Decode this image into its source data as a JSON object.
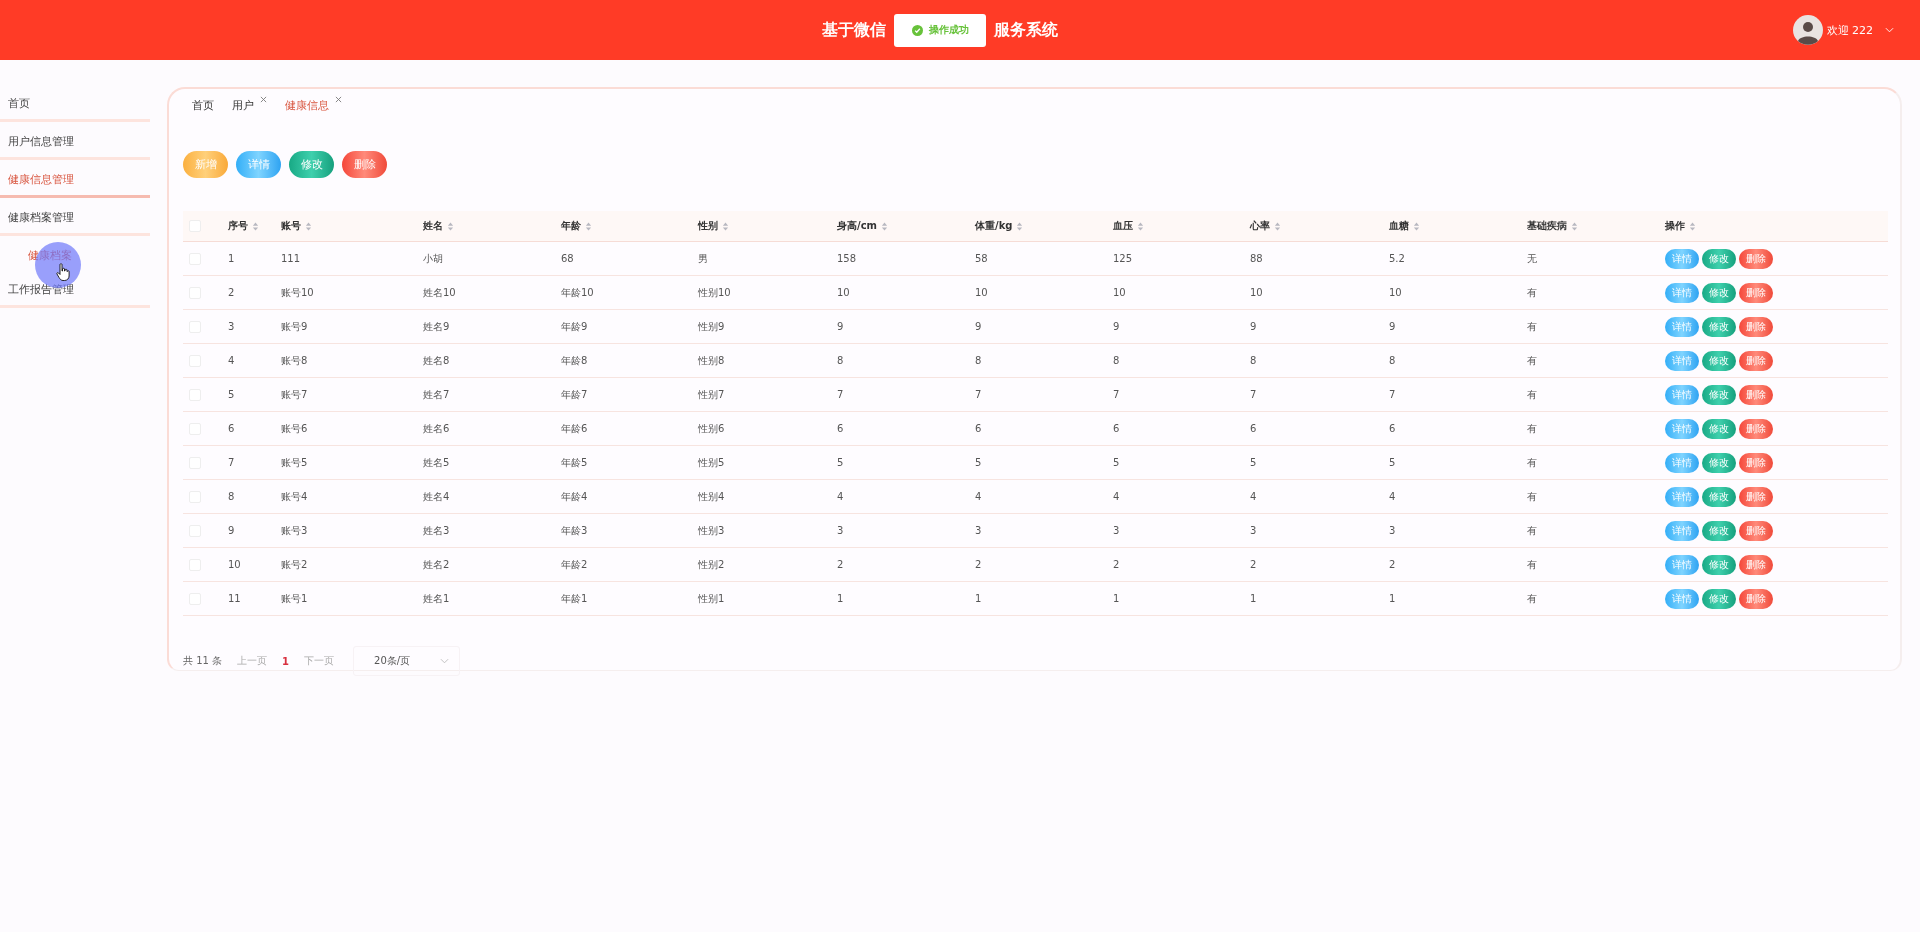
{
  "header": {
    "title_parts": [
      "基于微信",
      "服务系统"
    ],
    "user": "欢迎 222"
  },
  "toast": {
    "message": "操作成功"
  },
  "sidebar": {
    "items": [
      {
        "label": "首页",
        "selected": false
      },
      {
        "label": "用户信息管理",
        "selected": false
      },
      {
        "label": "健康信息管理",
        "selected": true
      },
      {
        "label": "健康档案管理",
        "selected": false,
        "children": [
          {
            "label": "健康档案",
            "hovered": true
          }
        ]
      },
      {
        "label": "工作报告管理",
        "selected": false
      }
    ]
  },
  "tabs": [
    {
      "label": "首页",
      "selected": false,
      "closable": false
    },
    {
      "label": "用户",
      "selected": false,
      "closable": true
    },
    {
      "label": "健康信息",
      "selected": true,
      "closable": true
    }
  ],
  "toolbar": [
    {
      "label": "新增",
      "kind": "add"
    },
    {
      "label": "详情",
      "kind": "detail"
    },
    {
      "label": "修改",
      "kind": "edit"
    },
    {
      "label": "删除",
      "kind": "delete"
    }
  ],
  "table": {
    "select_all": {
      "checked": false
    },
    "columns": [
      "序号",
      "账号",
      "姓名",
      "年龄",
      "性别",
      "身高/cm",
      "体重/kg",
      "血压",
      "心率",
      "血糖",
      "基础疾病",
      "操作"
    ],
    "rows": [
      {
        "checked": false,
        "cells": [
          "1",
          "111",
          "小胡",
          "68",
          "男",
          "158",
          "58",
          "125",
          "88",
          "5.2",
          "无"
        ],
        "actions": [
          {
            "label": "详情",
            "kind": "detail"
          },
          {
            "label": "修改",
            "kind": "edit"
          },
          {
            "label": "删除",
            "kind": "delete"
          }
        ]
      },
      {
        "checked": false,
        "cells": [
          "2",
          "账号10",
          "姓名10",
          "年龄10",
          "性别10",
          "10",
          "10",
          "10",
          "10",
          "10",
          "有"
        ],
        "actions": [
          {
            "label": "详情",
            "kind": "detail"
          },
          {
            "label": "修改",
            "kind": "edit"
          },
          {
            "label": "删除",
            "kind": "delete"
          }
        ]
      },
      {
        "checked": false,
        "cells": [
          "3",
          "账号9",
          "姓名9",
          "年龄9",
          "性别9",
          "9",
          "9",
          "9",
          "9",
          "9",
          "有"
        ],
        "actions": [
          {
            "label": "详情",
            "kind": "detail"
          },
          {
            "label": "修改",
            "kind": "edit"
          },
          {
            "label": "删除",
            "kind": "delete"
          }
        ]
      },
      {
        "checked": false,
        "cells": [
          "4",
          "账号8",
          "姓名8",
          "年龄8",
          "性别8",
          "8",
          "8",
          "8",
          "8",
          "8",
          "有"
        ],
        "actions": [
          {
            "label": "详情",
            "kind": "detail"
          },
          {
            "label": "修改",
            "kind": "edit"
          },
          {
            "label": "删除",
            "kind": "delete"
          }
        ]
      },
      {
        "checked": false,
        "cells": [
          "5",
          "账号7",
          "姓名7",
          "年龄7",
          "性别7",
          "7",
          "7",
          "7",
          "7",
          "7",
          "有"
        ],
        "actions": [
          {
            "label": "详情",
            "kind": "detail"
          },
          {
            "label": "修改",
            "kind": "edit"
          },
          {
            "label": "删除",
            "kind": "delete"
          }
        ]
      },
      {
        "checked": false,
        "cells": [
          "6",
          "账号6",
          "姓名6",
          "年龄6",
          "性别6",
          "6",
          "6",
          "6",
          "6",
          "6",
          "有"
        ],
        "actions": [
          {
            "label": "详情",
            "kind": "detail"
          },
          {
            "label": "修改",
            "kind": "edit"
          },
          {
            "label": "删除",
            "kind": "delete"
          }
        ]
      },
      {
        "checked": false,
        "cells": [
          "7",
          "账号5",
          "姓名5",
          "年龄5",
          "性别5",
          "5",
          "5",
          "5",
          "5",
          "5",
          "有"
        ],
        "actions": [
          {
            "label": "详情",
            "kind": "detail"
          },
          {
            "label": "修改",
            "kind": "edit"
          },
          {
            "label": "删除",
            "kind": "delete"
          }
        ]
      },
      {
        "checked": false,
        "cells": [
          "8",
          "账号4",
          "姓名4",
          "年龄4",
          "性别4",
          "4",
          "4",
          "4",
          "4",
          "4",
          "有"
        ],
        "actions": [
          {
            "label": "详情",
            "kind": "detail"
          },
          {
            "label": "修改",
            "kind": "edit"
          },
          {
            "label": "删除",
            "kind": "delete"
          }
        ]
      },
      {
        "checked": false,
        "cells": [
          "9",
          "账号3",
          "姓名3",
          "年龄3",
          "性别3",
          "3",
          "3",
          "3",
          "3",
          "3",
          "有"
        ],
        "actions": [
          {
            "label": "详情",
            "kind": "detail"
          },
          {
            "label": "修改",
            "kind": "edit"
          },
          {
            "label": "删除",
            "kind": "delete"
          }
        ]
      },
      {
        "checked": false,
        "cells": [
          "10",
          "账号2",
          "姓名2",
          "年龄2",
          "性别2",
          "2",
          "2",
          "2",
          "2",
          "2",
          "有"
        ],
        "actions": [
          {
            "label": "详情",
            "kind": "detail"
          },
          {
            "label": "修改",
            "kind": "edit"
          },
          {
            "label": "删除",
            "kind": "delete"
          }
        ]
      },
      {
        "checked": false,
        "cells": [
          "11",
          "账号1",
          "姓名1",
          "年龄1",
          "性别1",
          "1",
          "1",
          "1",
          "1",
          "1",
          "有"
        ],
        "actions": [
          {
            "label": "详情",
            "kind": "detail"
          },
          {
            "label": "修改",
            "kind": "edit"
          },
          {
            "label": "删除",
            "kind": "delete"
          }
        ]
      }
    ]
  },
  "pagination": {
    "total": "共 11 条",
    "prev": "上一页",
    "pages": [
      {
        "label": "1",
        "selected": true
      }
    ],
    "next": "下一页",
    "page_size": "20条/页"
  }
}
